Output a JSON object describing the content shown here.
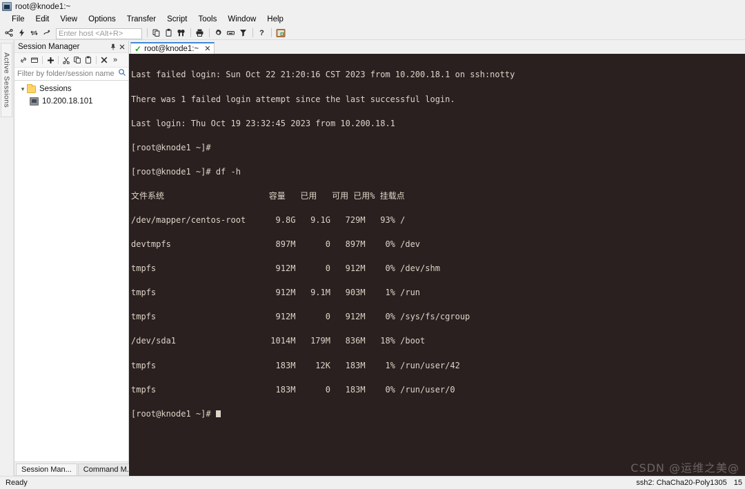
{
  "window": {
    "title": "root@knode1:~",
    "icon": "app-icon"
  },
  "menubar": {
    "items": [
      {
        "label": "File"
      },
      {
        "label": "Edit"
      },
      {
        "label": "View"
      },
      {
        "label": "Options"
      },
      {
        "label": "Transfer"
      },
      {
        "label": "Script"
      },
      {
        "label": "Tools"
      },
      {
        "label": "Window"
      },
      {
        "label": "Help"
      }
    ]
  },
  "toolbar": {
    "host_placeholder": "Enter host <Alt+R>",
    "host_value": "",
    "icons": [
      {
        "name": "connect-icon"
      },
      {
        "name": "quick-connect-icon"
      },
      {
        "name": "connect-in-tab-icon"
      },
      {
        "name": "reconnect-icon"
      },
      {
        "name": "copy-icon"
      },
      {
        "name": "paste-icon"
      },
      {
        "name": "find-icon"
      },
      {
        "name": "print-icon"
      },
      {
        "name": "session-options-icon"
      },
      {
        "name": "keymap-editor-icon"
      },
      {
        "name": "filter-icon"
      },
      {
        "name": "help-icon"
      },
      {
        "name": "image-icon"
      }
    ]
  },
  "active_sessions_rail": {
    "label": "Active Sessions"
  },
  "session_manager": {
    "title": "Session Manager",
    "pin_icon": "pin-icon",
    "close_icon": "close-icon",
    "toolbar_icons": [
      {
        "name": "link-icon"
      },
      {
        "name": "new-folder-icon"
      },
      {
        "name": "add-session-icon"
      },
      {
        "name": "cut-icon"
      },
      {
        "name": "copy-icon"
      },
      {
        "name": "paste-icon"
      },
      {
        "name": "delete-icon"
      },
      {
        "name": "more-icon",
        "glyph": "»"
      }
    ],
    "filter_placeholder": "Filter by folder/session name",
    "search_icon": "search-icon",
    "tree": {
      "root": {
        "label": "Sessions",
        "expanded": true
      },
      "children": [
        {
          "label": "10.200.18.101"
        }
      ]
    },
    "bottom_tabs": [
      {
        "label": "Session Man...",
        "active": true
      },
      {
        "label": "Command M...",
        "active": false
      }
    ]
  },
  "terminal": {
    "tab": {
      "label": "root@knode1:~",
      "status_icon": "connected-check-icon",
      "close_icon": "close-icon"
    },
    "colors": {
      "background": "#2a2020",
      "foreground": "#ddd5c6",
      "accent": "#3f88d8",
      "connected": "#22a822"
    },
    "lines": [
      "Last failed login: Sun Oct 22 21:20:16 CST 2023 from 10.200.18.1 on ssh:notty",
      "There was 1 failed login attempt since the last successful login.",
      "Last login: Thu Oct 19 23:32:45 2023 from 10.200.18.1",
      "[root@knode1 ~]#",
      "[root@knode1 ~]# df -h",
      "文件系统                     容量   已用   可用 已用% 挂载点",
      "/dev/mapper/centos-root      9.8G   9.1G   729M   93% /",
      "devtmpfs                     897M      0   897M    0% /dev",
      "tmpfs                        912M      0   912M    0% /dev/shm",
      "tmpfs                        912M   9.1M   903M    1% /run",
      "tmpfs                        912M      0   912M    0% /sys/fs/cgroup",
      "/dev/sda1                   1014M   179M   836M   18% /boot",
      "tmpfs                        183M    12K   183M    1% /run/user/42",
      "tmpfs                        183M      0   183M    0% /run/user/0"
    ],
    "prompt": "[root@knode1 ~]# "
  },
  "statusbar": {
    "left": "Ready",
    "cipher": "ssh2: ChaCha20-Poly1305",
    "counter": "15"
  },
  "watermark": {
    "text": "CSDN @运维之美@"
  }
}
